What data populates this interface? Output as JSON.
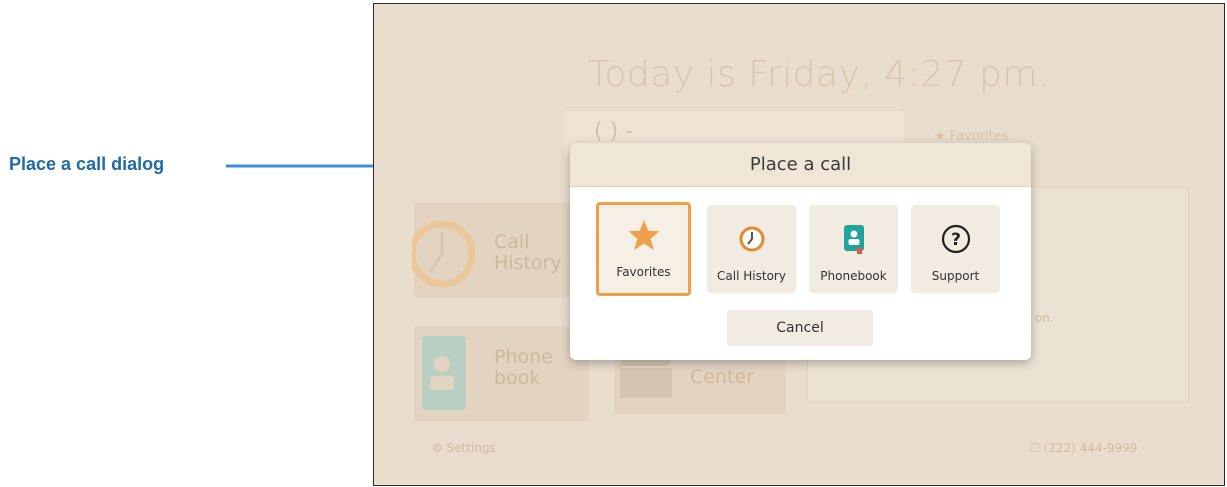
{
  "annotation": {
    "label": "Place a call dialog"
  },
  "background": {
    "greeting": "Today is Friday, 4:27 pm.",
    "dial_placeholder": "(   )   -",
    "favorites_link": "★ Favorites",
    "tiles": {
      "call_history": "Call\nHistory",
      "phonebook": "Phone\nbook",
      "center": "Center"
    },
    "card_text": "y on.",
    "settings": "Settings",
    "phone_number": "(222) 444-9999"
  },
  "dialog": {
    "title": "Place a call",
    "options": [
      {
        "label": "Favorites",
        "icon": "star-icon",
        "selected": true
      },
      {
        "label": "Call History",
        "icon": "clock-icon",
        "selected": false
      },
      {
        "label": "Phonebook",
        "icon": "phonebook-icon",
        "selected": false
      },
      {
        "label": "Support",
        "icon": "question-icon",
        "selected": false
      }
    ],
    "cancel_label": "Cancel"
  },
  "colors": {
    "accent": "#f0a04b",
    "annotation_blue": "#1f6aa8",
    "phonebook_teal": "#1fa39a"
  }
}
